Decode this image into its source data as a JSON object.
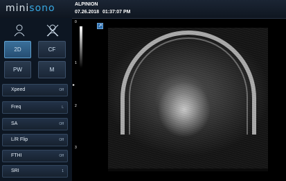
{
  "header": {
    "logo_prefix": "mini",
    "logo_suffix": "sono",
    "patient_name": "ALPINION",
    "date": "07.26.2018",
    "time": "01:37:07 PM"
  },
  "mode_buttons": [
    {
      "label": "2D",
      "selected": true
    },
    {
      "label": "CF",
      "selected": false
    },
    {
      "label": "PW",
      "selected": false
    },
    {
      "label": "M",
      "selected": false
    }
  ],
  "settings": [
    {
      "label": "Xpeed",
      "value": "Off"
    },
    {
      "label": "Freq",
      "value": "L"
    },
    {
      "label": "SA",
      "value": "Off"
    },
    {
      "label": "L/R Flip",
      "value": "Off"
    },
    {
      "label": "FTHI",
      "value": "Off"
    },
    {
      "label": "SRI",
      "value": "1"
    }
  ],
  "depth_scale": [
    "0",
    "1",
    "2",
    "3"
  ],
  "icons": {
    "patient": "person-icon",
    "end_exam": "person-cross-icon",
    "expand": "expand-icon",
    "focus": "focus-marker-icon"
  },
  "colors": {
    "accent": "#37a7e1",
    "selected_button": "#3a6f9a"
  }
}
